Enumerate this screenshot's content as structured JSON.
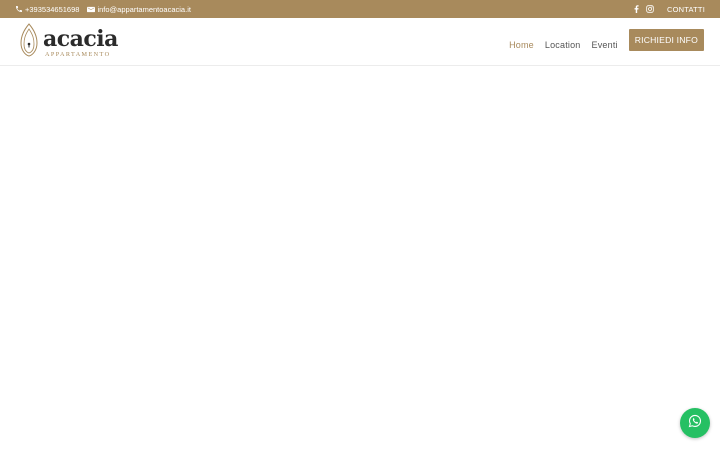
{
  "topbar": {
    "phone": "+393534651698",
    "email": "info@appartamentoacacia.it",
    "contact_label": "CONTATTI",
    "icons": [
      "phone-icon",
      "envelope-icon",
      "facebook-icon",
      "instagram-icon"
    ]
  },
  "logo": {
    "brand": "acacia",
    "subtitle": "APPARTAMENTO",
    "icon": "acacia-leaf-logo-icon"
  },
  "nav": {
    "items": [
      {
        "label": "Home",
        "active": true
      },
      {
        "label": "Location",
        "active": false
      },
      {
        "label": "Eventi",
        "active": false
      }
    ],
    "cta_label": "RICHIEDI INFO"
  },
  "floating": {
    "icon": "whatsapp-icon"
  },
  "colors": {
    "accent": "#a88a5c",
    "whatsapp": "#25c063",
    "nav_text": "#555555",
    "logo_text": "#2b2b2b"
  }
}
